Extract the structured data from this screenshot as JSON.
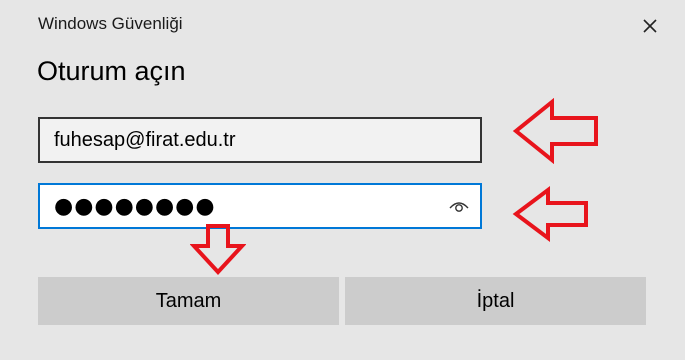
{
  "window": {
    "title": "Windows Güvenliği"
  },
  "dialog": {
    "heading": "Oturum açın",
    "username_value": "fuhesap@firat.edu.tr",
    "password_masked": "●●●●●●●●",
    "ok_label": "Tamam",
    "cancel_label": "İptal"
  },
  "icons": {
    "close": "close-icon",
    "reveal_password": "eye-icon",
    "annotation_arrow": "arrow-annotation"
  },
  "colors": {
    "background": "#e6e6e6",
    "focus_border": "#0078d7",
    "button_bg": "#cccccc",
    "annotation": "#e8141c"
  }
}
